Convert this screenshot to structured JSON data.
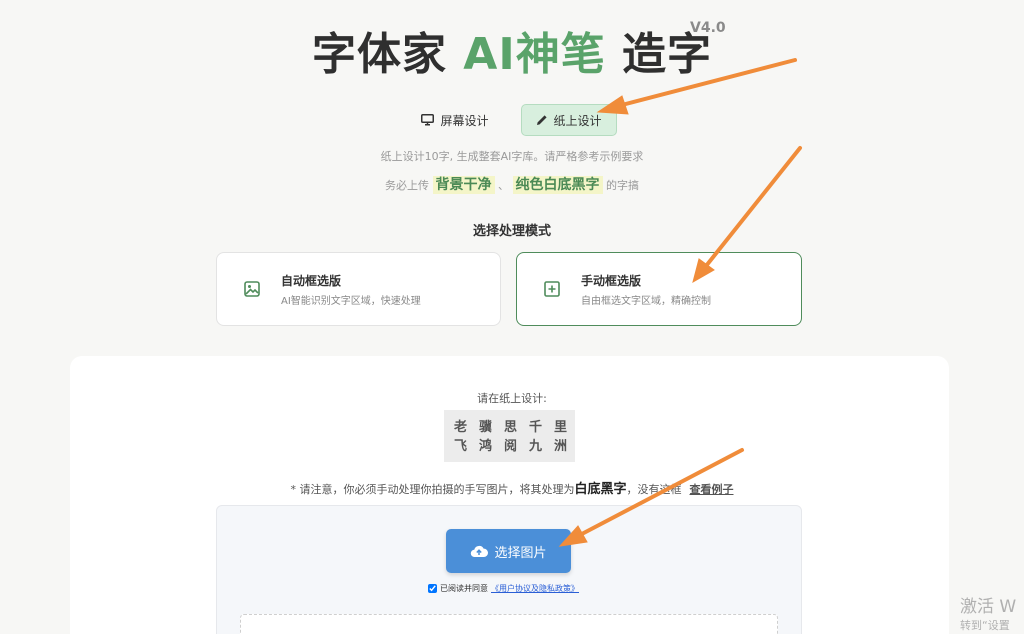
{
  "header": {
    "title_prefix": "字体家 ",
    "title_ai": "AI神笔",
    "title_suffix": " 造字",
    "version": "V4.0"
  },
  "mode_tabs": [
    {
      "label": "屏幕设计",
      "active": false
    },
    {
      "label": "纸上设计",
      "active": true
    }
  ],
  "hints": {
    "line1": "纸上设计10字, 生成整套AI字库。请严格参考示例要求",
    "line2_prefix": "务必上传",
    "highlight1": "背景干净",
    "sep": "、",
    "highlight2": "纯色白底黑字",
    "line2_suffix": "的字搞"
  },
  "processing": {
    "title": "选择处理模式",
    "options": [
      {
        "title": "自动框选版",
        "desc": "AI智能识别文字区域，快速处理",
        "selected": false
      },
      {
        "title": "手动框选版",
        "desc": "自由框选文字区域，精确控制",
        "selected": true
      }
    ]
  },
  "paper": {
    "label": "请在纸上设计:",
    "row1": [
      "老",
      "骥",
      "思",
      "千",
      "里"
    ],
    "row2": [
      "飞",
      "鸿",
      "阅",
      "九",
      "洲"
    ]
  },
  "notice": {
    "prefix": "* 请注意，你必须手动处理你拍摄的手写图片，将其处理为",
    "bold": "白底黑字",
    "suffix": "，没有这框",
    "link": "查看例子"
  },
  "upload": {
    "button": "选择图片",
    "agree_prefix": "已阅读并同意",
    "agree_link": "《用户协议及隐私政策》",
    "agree_checked": true
  },
  "watermark": {
    "line1": "激活 W",
    "line2": "转到“设置"
  },
  "colors": {
    "accent_green": "#5aa36a",
    "active_tab_bg": "#d8efde",
    "upload_blue": "#4b8fd8",
    "arrow_orange": "#f08c3a"
  }
}
